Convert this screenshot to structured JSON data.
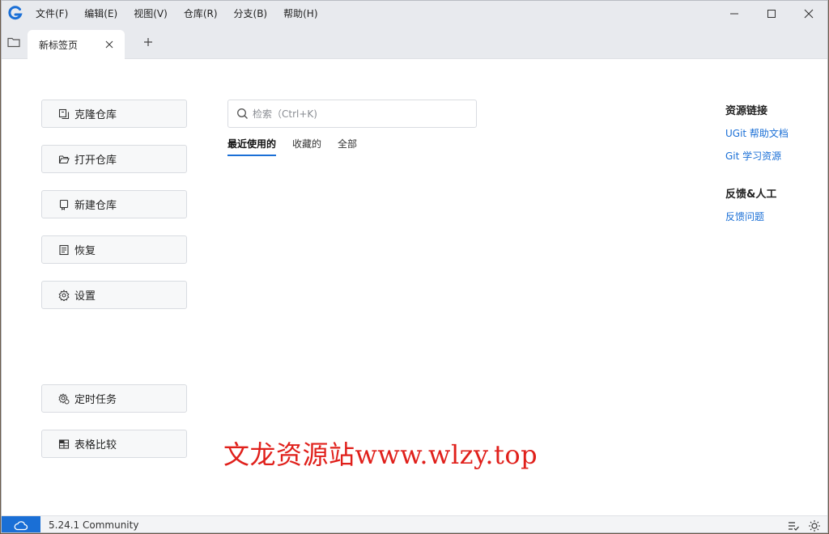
{
  "menu": [
    "文件(F)",
    "编辑(E)",
    "视图(V)",
    "仓库(R)",
    "分支(B)",
    "帮助(H)"
  ],
  "tab": {
    "label": "新标签页"
  },
  "actions_top": [
    "克隆仓库",
    "打开仓库",
    "新建仓库",
    "恢复",
    "设置"
  ],
  "actions_bottom": [
    "定时任务",
    "表格比较"
  ],
  "search": {
    "placeholder": "检索（Ctrl+K)"
  },
  "filters": [
    "最近使用的",
    "收藏的",
    "全部"
  ],
  "resources": {
    "heading": "资源链接",
    "links": [
      "UGit 帮助文档",
      "Git 学习资源"
    ]
  },
  "feedback": {
    "heading": "反馈&人工",
    "links": [
      "反馈问题"
    ]
  },
  "watermark": "文龙资源站www.wlzy.top",
  "status": {
    "version": "5.24.1 Community"
  },
  "colors": {
    "accent": "#1a6fd6",
    "watermark": "#e0201b"
  },
  "icons": [
    "app-logo-icon",
    "folder-icon",
    "close-icon",
    "plus-icon",
    "clone-icon",
    "folder-open-icon",
    "repo-icon",
    "restore-icon",
    "gear-icon",
    "task-icon",
    "table-icon",
    "search-icon",
    "cloud-icon",
    "list-check-icon",
    "sun-icon"
  ]
}
